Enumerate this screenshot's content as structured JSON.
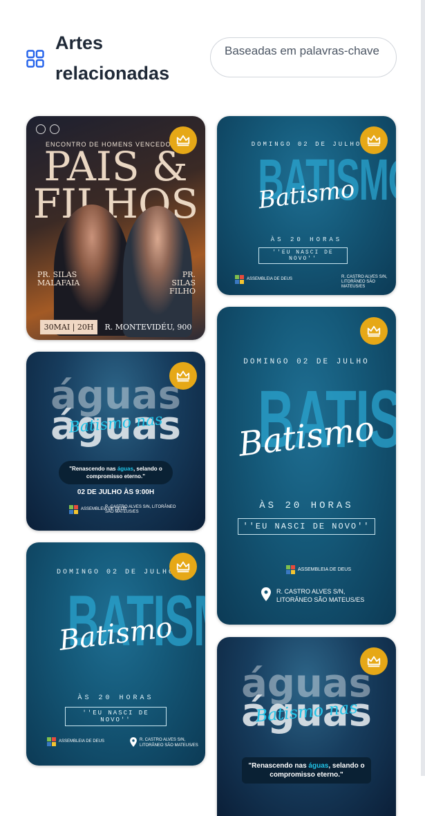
{
  "header": {
    "title": "Artes relacionadas",
    "keyword_filter": "Baseadas em palavras-chave"
  },
  "icons": {
    "grid": "grid-icon",
    "crown": "crown-icon",
    "location": "location-pin-icon"
  },
  "colors": {
    "accent_blue": "#2563eb",
    "crown_gold": "#e6a817",
    "aqua_highlight": "#21c4e8"
  },
  "cards": {
    "pais_filhos": {
      "subtitle": "ENCONTRO DE HOMENS VENCEDORES",
      "title_line1": "PAIS &",
      "title_line2": "FILHOS",
      "speaker1": "PR. SILAS MALAFAIA",
      "speaker2": "PR. SILAS FILHO",
      "date": "30MAI | 20H",
      "address": "R. MONTEVIDÉU, 900"
    },
    "batismo": {
      "date": "DOMINGO 02 DE JULHO",
      "bg_word": "BATISMO",
      "script": "Batismo",
      "hours": "ÀS 20 HORAS",
      "quote": "''EU NASCI DE NOVO''",
      "church": "ASSEMBLEIA DE DEUS",
      "address_line1": "R. CASTRO ALVES S/N,",
      "address_line2": "LITORÂNEO SÃO MATEUS/ES"
    },
    "aguas": {
      "big_word": "águas",
      "script": "Batismo nas",
      "quote_pre": "\"Renascendo nas ",
      "quote_hl": "águas",
      "quote_post": ", selando o compromisso eterno.\"",
      "date": "02 DE JULHO ÀS 9:00H",
      "address": "R. CASTRO ALVES S/N, LITORÂNEO SÃO MATEUS/ES"
    }
  }
}
